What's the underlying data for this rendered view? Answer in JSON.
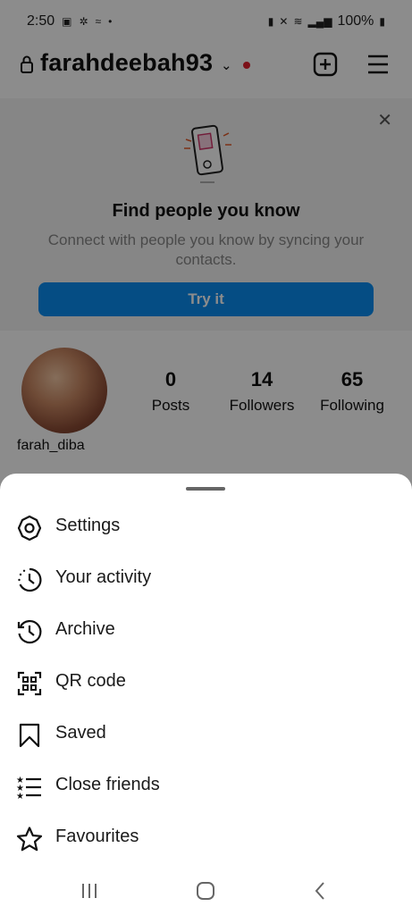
{
  "status_bar": {
    "time": "2:50",
    "battery": "100%"
  },
  "header": {
    "username": "farahdeebah93"
  },
  "contacts_card": {
    "title": "Find people you know",
    "subtitle": "Connect with people you know by syncing your contacts.",
    "button": "Try it"
  },
  "profile": {
    "name": "farah_diba",
    "stats": [
      {
        "value": "0",
        "label": "Posts"
      },
      {
        "value": "14",
        "label": "Followers"
      },
      {
        "value": "65",
        "label": "Following"
      }
    ]
  },
  "menu": {
    "items": [
      {
        "label": "Settings",
        "icon": "settings-gear-icon"
      },
      {
        "label": "Your activity",
        "icon": "activity-clock-icon"
      },
      {
        "label": "Archive",
        "icon": "archive-history-icon"
      },
      {
        "label": "QR code",
        "icon": "qr-code-icon"
      },
      {
        "label": "Saved",
        "icon": "bookmark-icon"
      },
      {
        "label": "Close friends",
        "icon": "close-friends-list-icon"
      },
      {
        "label": "Favourites",
        "icon": "star-icon"
      }
    ]
  },
  "colors": {
    "accent": "#0a8cf0",
    "live_dot": "#e21f2f"
  }
}
